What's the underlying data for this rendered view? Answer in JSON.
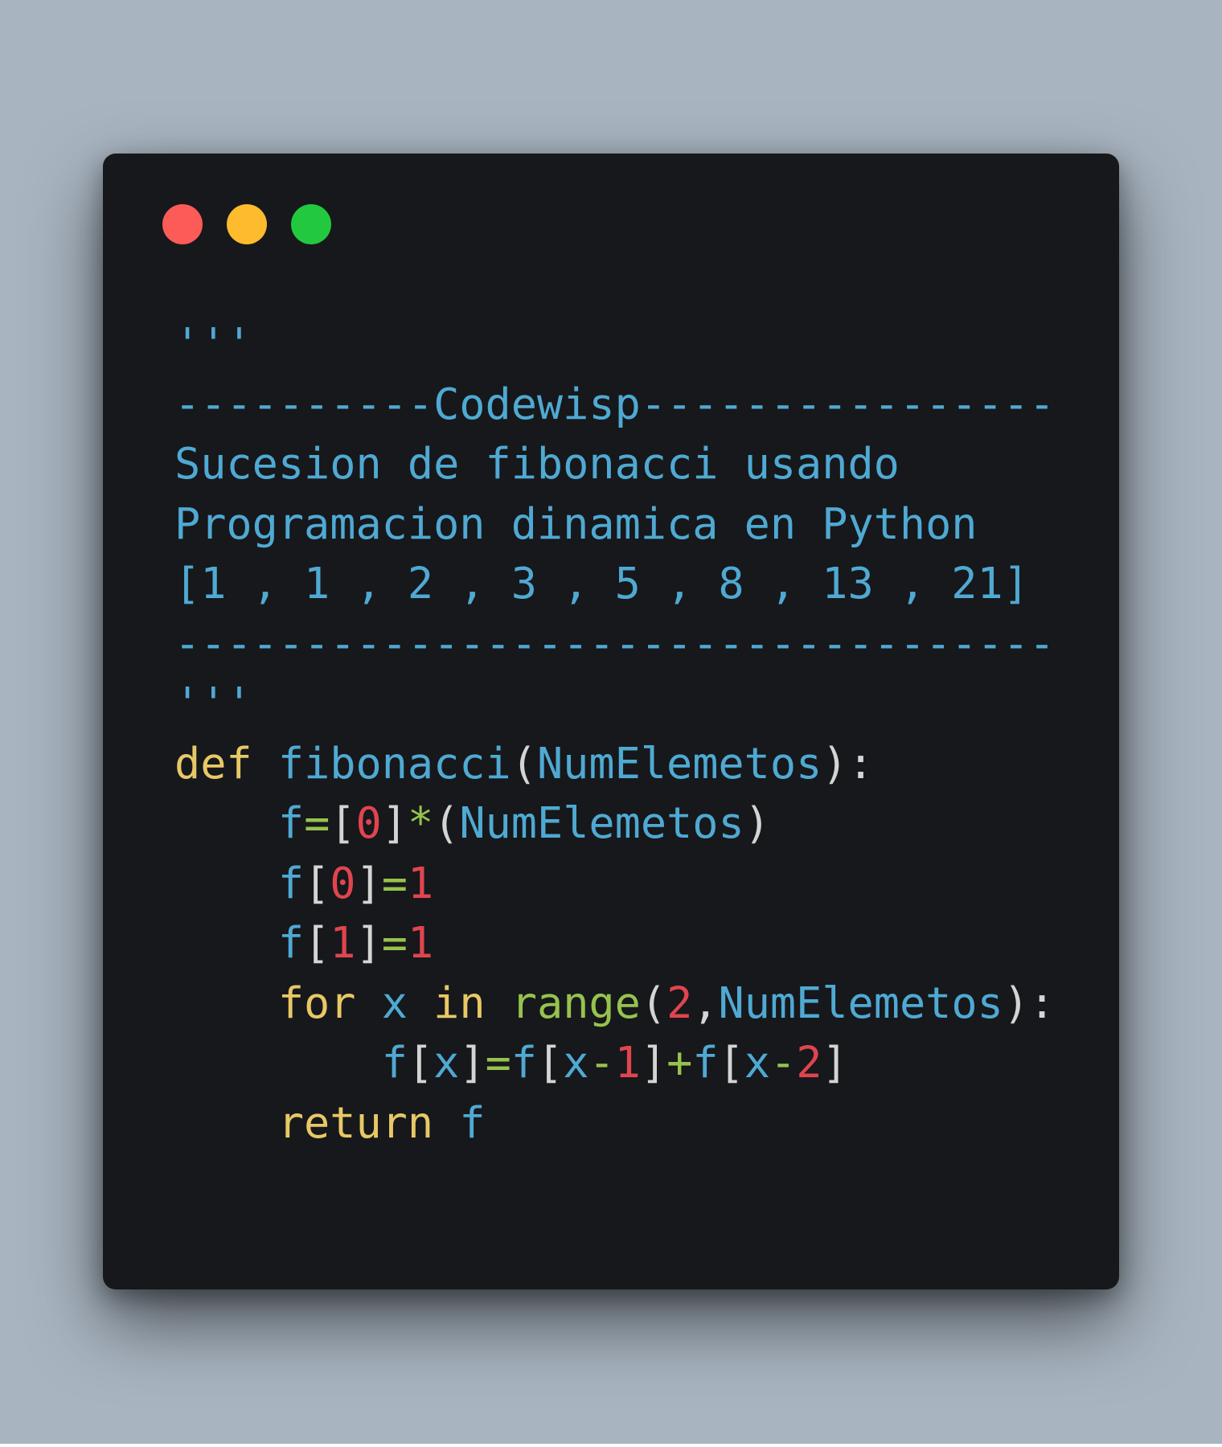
{
  "colors": {
    "background": "#a8b4c0",
    "window": "#16181b",
    "close": "#fd5b58",
    "minimize": "#fdbb2d",
    "zoom": "#22c93f",
    "comment": "#4fa9d3",
    "keyword": "#e8c866",
    "identifier": "#4fa9d3",
    "number": "#e0454f",
    "operator": "#97c24e",
    "punctuation": "#d4d4d4"
  },
  "window_controls": [
    "close-button",
    "minimize-button",
    "zoom-button"
  ],
  "code": {
    "docstring": {
      "open": "'''",
      "banner": "----------Codewisp----------------",
      "line1": "Sucesion de fibonacci usando",
      "line2": "Programacion dinamica en Python",
      "sequence": "[1 , 1 , 2 , 3 , 5 , 8 , 13 , 21]",
      "rule": "----------------------------------",
      "close": "'''"
    },
    "def_line": {
      "keyword": "def",
      "func": "fibonacci",
      "paren_open": "(",
      "param": "NumElemetos",
      "tail": "):"
    },
    "init_line": {
      "var": "f",
      "eq": "=",
      "bracket_open": "[",
      "zero": "0",
      "bracket_close": "]",
      "mul": "*",
      "paren_open": "(",
      "param": "NumElemetos",
      "paren_close": ")"
    },
    "f0_line": {
      "var": "f",
      "bracket_open": "[",
      "index": "0",
      "bracket_close": "]",
      "eq": "=",
      "value": "1"
    },
    "f1_line": {
      "var": "f",
      "bracket_open": "[",
      "index": "1",
      "bracket_close": "]",
      "eq": "=",
      "value": "1"
    },
    "for_line": {
      "kw_for": "for",
      "var": "x",
      "kw_in": "in",
      "builtin": "range",
      "paren_open": "(",
      "start": "2",
      "comma": ",",
      "param": "NumElemetos",
      "tail": "):"
    },
    "body_line": {
      "f1": "f",
      "b1o": "[",
      "x1": "x",
      "b1c": "]",
      "eq": "=",
      "f2": "f",
      "b2o": "[",
      "x2": "x",
      "minus1": "-",
      "n1": "1",
      "b2c": "]",
      "plus": "+",
      "f3": "f",
      "b3o": "[",
      "x3": "x",
      "minus2": "-",
      "n2": "2",
      "b3c": "]"
    },
    "return_line": {
      "keyword": "return",
      "var": "f"
    }
  }
}
